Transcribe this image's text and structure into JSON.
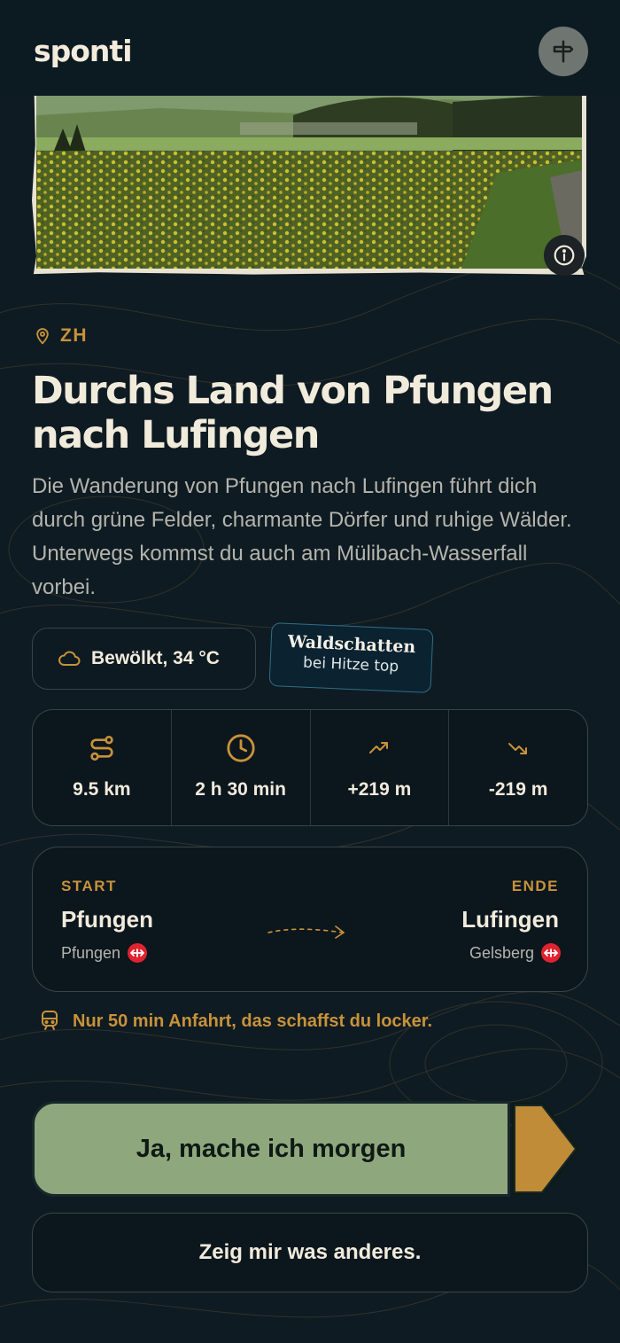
{
  "app": {
    "brand": "sponti"
  },
  "colors": {
    "accent": "#c8923a",
    "cta": "#8fa77d",
    "background": "#0f1b22"
  },
  "header": {
    "route_icon": "signpost-icon"
  },
  "hike": {
    "canton": "ZH",
    "title": "Durchs Land von Pfungen nach Lufingen",
    "description": "Die Wanderung von Pfungen nach Lufingen führt dich durch grüne Felder, charmante Dörfer und ruhige Wälder. Unterwegs kommst du auch am Mülibach-Wasserfall vorbei."
  },
  "weather": {
    "label": "Bewölkt, 34 °C",
    "icon": "cloud-icon"
  },
  "sticker": {
    "line1": "Waldschatten",
    "line2": "bei Hitze top"
  },
  "stats": [
    {
      "icon": "route-icon",
      "value": "9.5 km"
    },
    {
      "icon": "clock-icon",
      "value": "2 h 30 min"
    },
    {
      "icon": "trending-up-icon",
      "value": "+219 m"
    },
    {
      "icon": "trending-down-icon",
      "value": "-219 m"
    }
  ],
  "route": {
    "start_label": "START",
    "start_town": "Pfungen",
    "start_stop": "Pfungen",
    "end_label": "ENDE",
    "end_town": "Lufingen",
    "end_stop": "Gelsberg"
  },
  "transit": {
    "text": "Nur 50 min Anfahrt, das schaffst du locker.",
    "icon": "train-icon"
  },
  "actions": {
    "primary": "Ja, mache ich morgen",
    "secondary": "Zeig mir was anderes."
  }
}
